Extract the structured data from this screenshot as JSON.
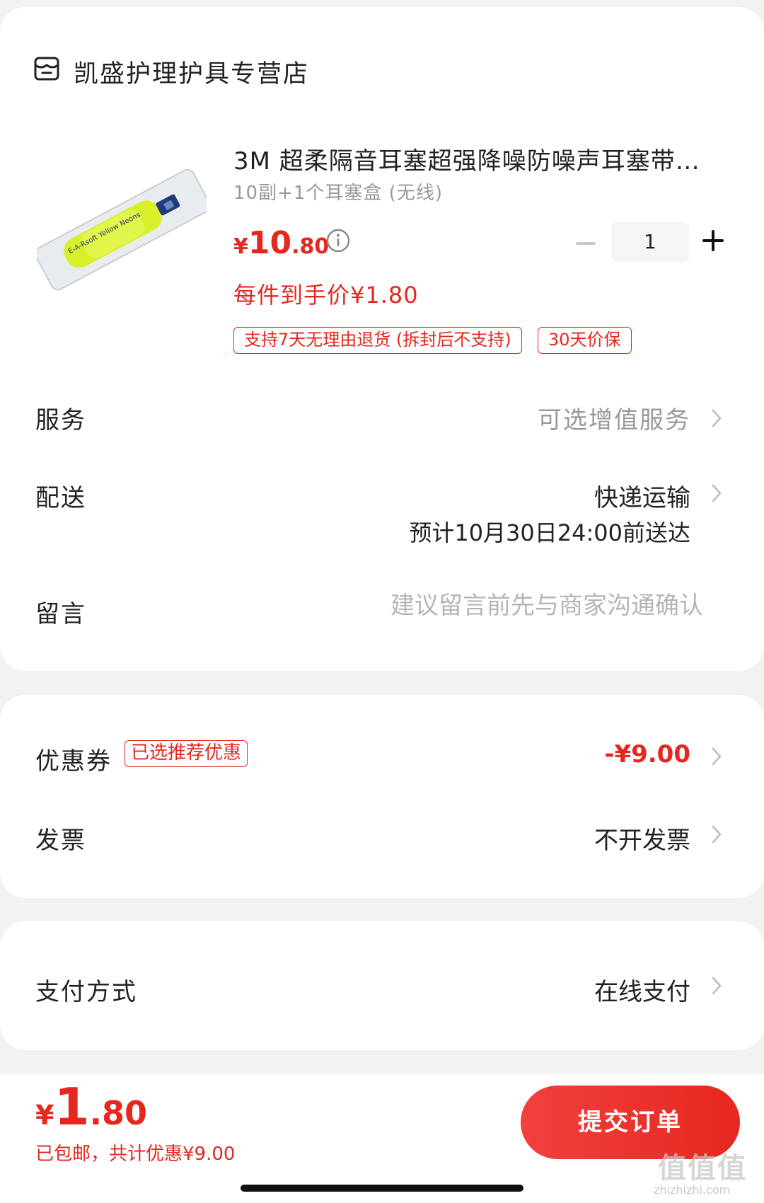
{
  "store": {
    "name": "凯盛护理护具专营店",
    "icon": "store-icon"
  },
  "product": {
    "title": "3M 超柔隔音耳塞超强降噪防噪声耳塞带…",
    "spec": "10副+1个耳塞盒 (无线)",
    "price_yen": "¥",
    "price_int": "10",
    "price_dec": ".80",
    "unit_price": "每件到手价¥1.80",
    "tags": [
      "支持7天无理由退货 (拆封后不支持)",
      "30天价保"
    ],
    "image_text": "E-A-Rsoft Yellow Neons"
  },
  "quantity": {
    "value": "1",
    "minus": "−",
    "plus": "+"
  },
  "rows": {
    "service": {
      "label": "服务",
      "value": "可选增值服务"
    },
    "delivery": {
      "label": "配送",
      "value": "快递运输",
      "eta": "预计10月30日24:00前送达"
    },
    "message": {
      "label": "留言",
      "placeholder": "建议留言前先与商家沟通确认"
    },
    "coupon": {
      "label": "优惠券",
      "badge": "已选推荐优惠",
      "value": "-¥9.00"
    },
    "invoice": {
      "label": "发票",
      "value": "不开发票"
    },
    "payment": {
      "label": "支付方式",
      "value": "在线支付"
    }
  },
  "footer": {
    "total_yen": "¥",
    "total_int": "1",
    "total_dec": ".80",
    "note": "已包邮，共计优惠¥9.00",
    "submit": "提交订单"
  },
  "watermark": {
    "main": "值值值",
    "sub": "zhizhizhi.com"
  },
  "colors": {
    "accent": "#e5271f",
    "muted": "#999999",
    "background": "#f2f2f2"
  }
}
